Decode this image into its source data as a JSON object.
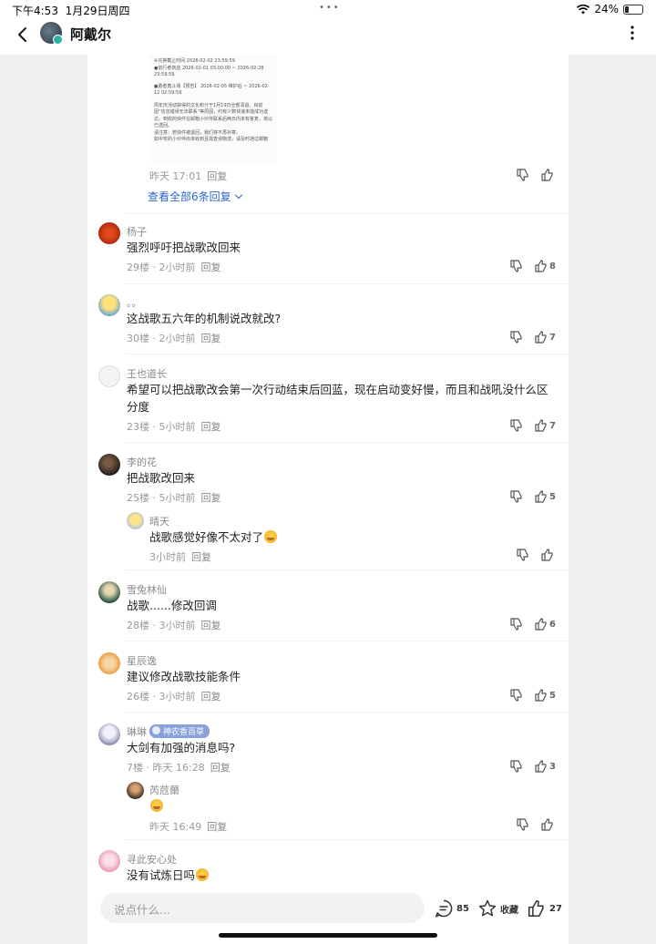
{
  "status_bar": {
    "time": "下午4:53",
    "date": "1月29日周四",
    "dots": "•••",
    "battery": "24%",
    "battery_level": 0.24
  },
  "header": {
    "title": "阿戴尔"
  },
  "preview": {
    "lines": [
      "※兑换截止时间 2026-02-02 23:59:59",
      "●前行者商店 2026-02-01 03:00:00 ~ 2026-02-28 23:59:59",
      "●勇者角斗场【预告】 2026-02-05 维护后 ~ 2026-02-12 02:59:59",
      "周年庆活动获得的文化积分于1月19日全部清退。目前因“信息错误无法联系”等原因，约有少数快递未能成功送达。到收的快件在邮箱小伙伴联系后两日内未有答复，将以已送回。",
      "请注意：若快件被退回，我们将不再补寄。",
      "如中奖的小伙伴尚未收到且需查询物流，请及时通过邮箱"
    ],
    "meta_time": "昨天 17:01",
    "meta_reply": "回复",
    "view_all": "查看全部6条回复"
  },
  "comments": [
    {
      "user": "杨子",
      "text": "强烈呼吁把战歌改回来",
      "floor": "29楼",
      "time": "2小时前",
      "reply": "回复",
      "likes": "8"
    },
    {
      "user": "。。",
      "text": "这战歌五六年的机制说改就改?",
      "floor": "30楼",
      "time": "2小时前",
      "reply": "回复",
      "likes": "7"
    },
    {
      "user": "王也道长",
      "text_line1": "希望可以把战歌改会第一次行动结束后回蓝，现在启动变好慢，而且和战吼没什么区",
      "text_line2": "分度",
      "floor": "23楼",
      "time": "5小时前",
      "reply": "回复",
      "likes": "7"
    },
    {
      "user": "李的花",
      "text": "把战歌改回来",
      "floor": "25楼",
      "time": "5小时前",
      "reply": "回复",
      "likes": "5",
      "sub": {
        "user": "晴天",
        "text": "战歌感觉好像不太对了",
        "time": "3小时前",
        "reply": "回复"
      }
    },
    {
      "user": "雪兔林仙",
      "text": "战歌......修改回调",
      "floor": "28楼",
      "time": "3小时前",
      "reply": "回复",
      "likes": "6"
    },
    {
      "user": "星辰逸",
      "text": "建议修改战歌技能条件",
      "floor": "26楼",
      "time": "3小时前",
      "reply": "回复",
      "likes": "5"
    },
    {
      "user": "琳琳",
      "badge": "神农香百草",
      "text": "大剑有加强的消息吗?",
      "floor": "7楼",
      "time": "昨天 16:28",
      "reply": "回复",
      "likes": "3",
      "sub": {
        "user": "芮苊薾",
        "time": "昨天 16:49",
        "reply": "回复"
      }
    },
    {
      "user": "寻此安心处",
      "text": "没有试炼日吗"
    }
  ],
  "bottom": {
    "placeholder": "说点什么...",
    "comments": "85",
    "collect": "收藏",
    "likes": "27"
  },
  "colors": {
    "link": "#2b66c9",
    "badge": "#8aa0d8",
    "verified": "#27b3a0"
  },
  "icons": [
    "back-arrow-icon",
    "more-vertical-icon",
    "dislike-icon",
    "like-icon",
    "comment-icon",
    "star-icon",
    "wifi-icon",
    "battery-icon"
  ]
}
